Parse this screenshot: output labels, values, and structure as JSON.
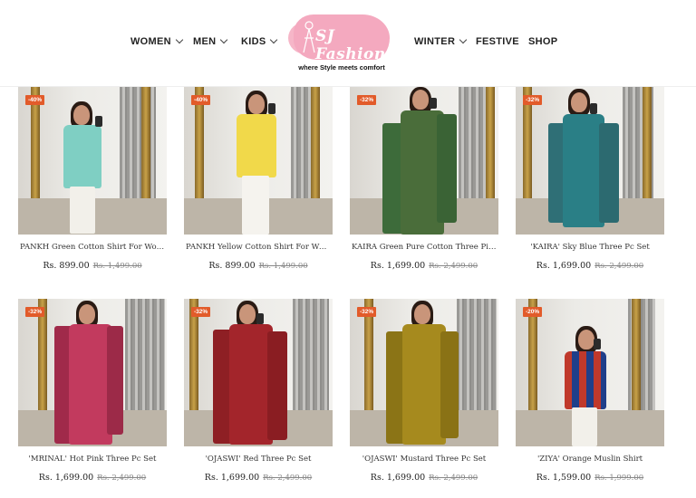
{
  "nav": {
    "women": "WOMEN",
    "men": "MEN",
    "kids": "KIDS",
    "winter": "WINTER",
    "festive": "FESTIVE",
    "shop": "SHOP"
  },
  "logo": {
    "text": "SJ Fashions",
    "tagline": "where Style meets comfort"
  },
  "products": [
    {
      "badge": "-40%",
      "title": "PANKH Green Cotton Shirt For Wome...",
      "price": "Rs. 899.00",
      "old_price": "Rs. 1,499.00"
    },
    {
      "badge": "-40%",
      "title": "PANKH Yellow Cotton Shirt For Wome...",
      "price": "Rs. 899.00",
      "old_price": "Rs. 1,499.00"
    },
    {
      "badge": "-32%",
      "title": "KAIRA Green Pure Cotton Three Piece...",
      "price": "Rs. 1,699.00",
      "old_price": "Rs. 2,499.00"
    },
    {
      "badge": "-32%",
      "title": "'KAIRA' Sky Blue Three Pc Set",
      "price": "Rs. 1,699.00",
      "old_price": "Rs. 2,499.00"
    },
    {
      "badge": "-32%",
      "title": "'MRINAL' Hot Pink Three Pc Set",
      "price": "Rs. 1,699.00",
      "old_price": "Rs. 2,499.00"
    },
    {
      "badge": "-32%",
      "title": "'OJASWI' Red Three Pc Set",
      "price": "Rs. 1,699.00",
      "old_price": "Rs. 2,499.00"
    },
    {
      "badge": "-32%",
      "title": "'OJASWI' Mustard Three Pc Set",
      "price": "Rs. 1,699.00",
      "old_price": "Rs. 2,499.00"
    },
    {
      "badge": "-20%",
      "title": "'ZIYA' Orange Muslin Shirt",
      "price": "Rs. 1,599.00",
      "old_price": "Rs. 1,999.00"
    }
  ],
  "colors": {
    "badge": "#e25b2a",
    "logo_pink": "#f4a9bf"
  }
}
